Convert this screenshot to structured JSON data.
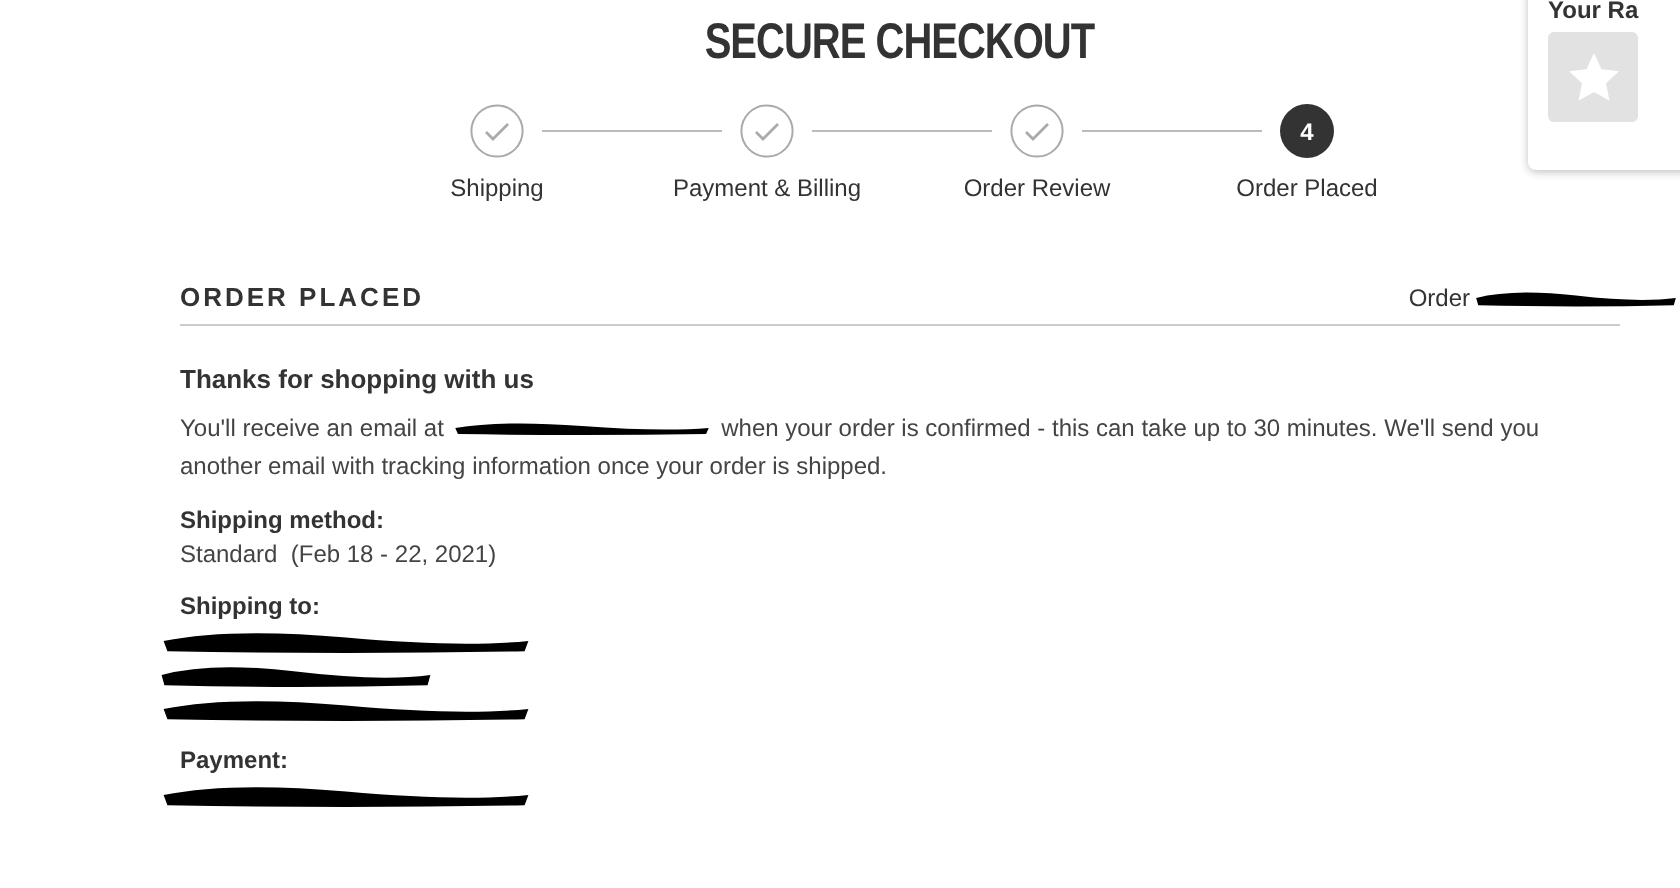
{
  "title": "SECURE CHECKOUT",
  "steps": [
    {
      "label": "Shipping",
      "completed": true,
      "selected": false
    },
    {
      "label": "Payment & Billing",
      "completed": true,
      "selected": false
    },
    {
      "label": "Order Review",
      "completed": true,
      "selected": false
    },
    {
      "label": "Order Placed",
      "completed": false,
      "selected": true,
      "number": "4"
    }
  ],
  "rating_panel": {
    "label": "Your Ra"
  },
  "order": {
    "heading": "ORDER PLACED",
    "order_label": "Order",
    "thanks": "Thanks for shopping with us",
    "message_start": "You'll receive an email at",
    "message_end": "when your order is confirmed - this can take up to 30 minutes. We'll send you another email with tracking information once your order is shipped.",
    "sections": [
      {
        "label": "Shipping method:",
        "value": "Standard  (Feb 18 - 22, 2021)"
      },
      {
        "label": "Shipping to:",
        "kind": "redacted_address"
      },
      {
        "label": "Payment:",
        "kind": "redacted_payment"
      }
    ]
  }
}
